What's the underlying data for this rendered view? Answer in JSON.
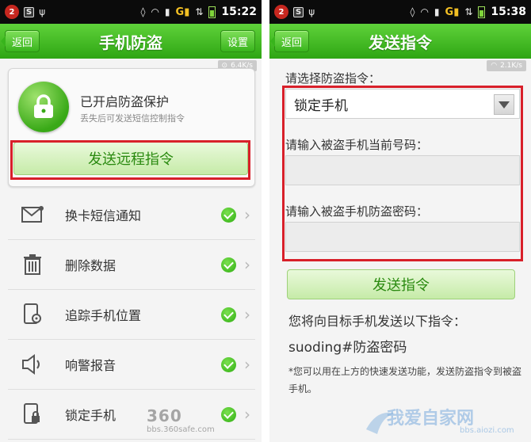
{
  "left": {
    "status": {
      "badge": "2",
      "time": "15:22"
    },
    "header": {
      "back": "返回",
      "title": "手机防盗",
      "settings": "设置"
    },
    "speed": "6.4K/s",
    "protection": {
      "title": "已开启防盗保护",
      "subtitle": "丢失后可发送短信控制指令"
    },
    "remote_button": "发送远程指令",
    "features": [
      {
        "label": "换卡短信通知",
        "icon": "sim-sms-icon"
      },
      {
        "label": "删除数据",
        "icon": "trash-icon"
      },
      {
        "label": "追踪手机位置",
        "icon": "location-icon"
      },
      {
        "label": "响警报音",
        "icon": "speaker-icon"
      },
      {
        "label": "锁定手机",
        "icon": "phone-lock-icon"
      }
    ],
    "watermark": {
      "logo": "360",
      "url": "bbs.360safe.com"
    }
  },
  "right": {
    "status": {
      "badge": "2",
      "time": "15:38"
    },
    "header": {
      "back": "返回",
      "title": "发送指令"
    },
    "speed": "2.1K/s",
    "select_label": "请选择防盗指令：",
    "selected_command": "锁定手机",
    "number_label": "请输入被盗手机当前号码：",
    "password_label": "请输入被盗手机防盗密码：",
    "send_button": "发送指令",
    "info_line1": "您将向目标手机发送以下指令：",
    "info_line2": "suoding#防盗密码",
    "note": "*您可以用在上方的快速发送功能，发送防盗指令到被盗手机。",
    "watermark": {
      "big": "我爱自家网",
      "small": "bbs.aiozi.com"
    }
  },
  "colors": {
    "accent": "#2ea513",
    "highlight": "#d8202a",
    "button_text": "#2a8a10"
  }
}
